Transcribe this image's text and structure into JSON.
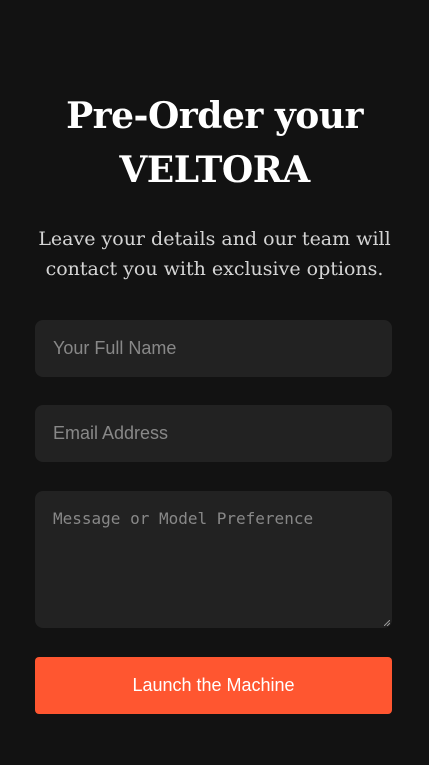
{
  "form": {
    "title_line1": "Pre-Order your",
    "title_line2": "VELTORA",
    "subtitle": "Leave your details and our team will contact you with exclusive options.",
    "name_placeholder": "Your Full Name",
    "email_placeholder": "Email Address",
    "message_placeholder": "Message or Model Preference",
    "submit_label": "Launch the Machine"
  },
  "colors": {
    "background": "#121212",
    "field": "#222222",
    "accent": "#ff5630"
  }
}
